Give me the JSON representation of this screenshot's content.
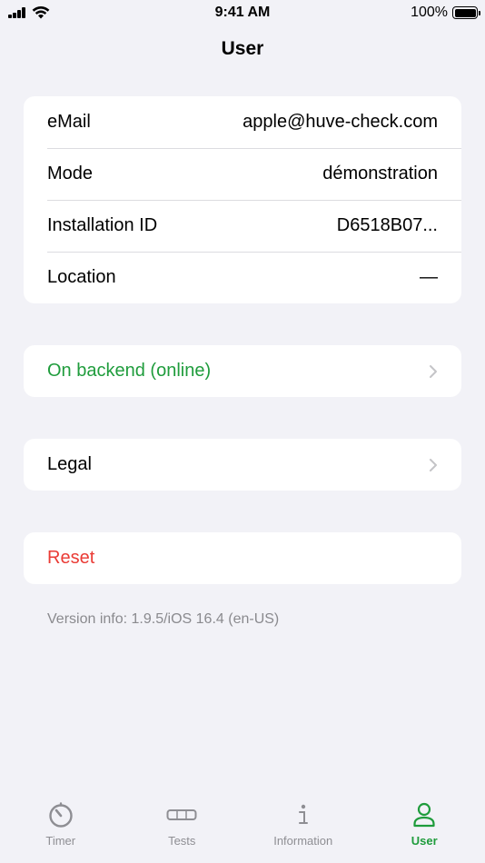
{
  "status_bar": {
    "time": "9:41 AM",
    "battery": "100%"
  },
  "nav": {
    "title": "User"
  },
  "info": {
    "rows": [
      {
        "label": "eMail",
        "value": "apple@huve-check.com"
      },
      {
        "label": "Mode",
        "value": "démonstration"
      },
      {
        "label": "Installation ID",
        "value": "D6518B07..."
      },
      {
        "label": "Location",
        "value": "—"
      }
    ]
  },
  "backend": {
    "label": "On backend (online)"
  },
  "legal": {
    "label": "Legal"
  },
  "reset": {
    "label": "Reset"
  },
  "version": {
    "text": "Version info: 1.9.5/iOS 16.4 (en-US)"
  },
  "tabs": [
    {
      "label": "Timer",
      "icon": "timer-icon"
    },
    {
      "label": "Tests",
      "icon": "test-strip-icon"
    },
    {
      "label": "Information",
      "icon": "info-icon"
    },
    {
      "label": "User",
      "icon": "person-icon",
      "active": true
    }
  ],
  "colors": {
    "accent": "#1f9c3c",
    "destructive": "#ea3b35",
    "background": "#f2f2f7"
  }
}
